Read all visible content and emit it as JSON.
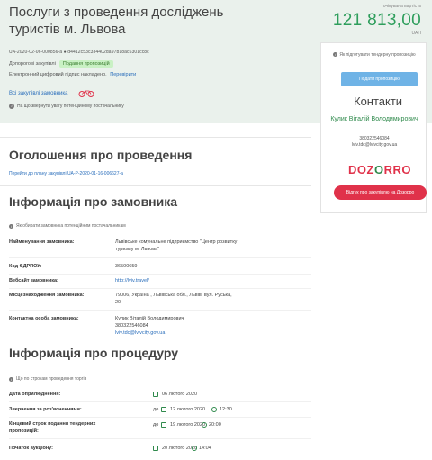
{
  "header": {
    "title": "Послуги з проведення досліджень туристів м. Львова",
    "tender_id": "UA-2020-02-06-000856-a ● d4412c53c334402da97b18ac6301cc8c",
    "procedure": "Допорогові закупівлі",
    "status": "Подання пропозицій",
    "signature_text": "Електронний цифровий підпис накладено.",
    "signature_link": "Перевірити",
    "all_purchases": "Всі закупівлі замовника",
    "notice": "На що звернути увагу потенційному постачальнику"
  },
  "value": {
    "label": "очікувана вартість",
    "amount": "121 813,00",
    "currency": "UAH"
  },
  "sidebar": {
    "help_question": "Як підготувати тендерну пропозицію",
    "ask_button": "Подати пропозицію",
    "contacts_title": "Контакти",
    "contact_name": "Кулик Віталій Володимирович",
    "contact_phone": "380322546084",
    "contact_email": "lviv.tdc@lvivcity.gov.ua",
    "logo_left": "DO",
    "logo_mid": "Z",
    "logo_o": "O",
    "logo_right": "RRO",
    "complain_button": "Відгук про закупівлю на Дозорро"
  },
  "announcement": {
    "title": "Оголошення про проведення",
    "plan_link": "Перейти до плану закупівлі UA-P-2020-01-16-006627-a"
  },
  "buyer": {
    "title": "Інформація про замовника",
    "notice": "Як обирати замовника потенційним постачальникам",
    "rows": [
      {
        "label": "Найменування замовника:",
        "value": "Львівське комунальне підприємство \"Центр розвитку туризму м. Львова\""
      },
      {
        "label": "Код ЄДРПОУ:",
        "value": "36500659"
      },
      {
        "label": "Вебсайт замовника:",
        "value": "http://lviv.travel/"
      },
      {
        "label": "Місцезнаходження замовника:",
        "value": "79006, Україна , Львівська обл., Львів, вул. Руська, 20"
      },
      {
        "label": "Контактна особа замовника:",
        "value_name": "Кулик Віталій Володимирович",
        "value_phone": "380322546084",
        "value_email": "lviv.tdc@lvivcity.gov.ua"
      }
    ]
  },
  "procedure": {
    "title": "Інформація про процедуру",
    "notice": "Що по строкам проведення торгів",
    "rows": [
      {
        "label": "Дата оприлюднення:",
        "date": "06 лютого 2020"
      },
      {
        "label": "Звернення за роз'ясненнями:",
        "prefix": "до",
        "date": "12 лютого 2020",
        "time": "12:30"
      },
      {
        "label": "Кінцевий строк подання тендерних пропозицій:",
        "prefix": "до",
        "date": "19 лютого 2020",
        "time": "20:00"
      },
      {
        "label": "Початок аукціону:",
        "date": "20 лютого 2020",
        "time": "14:04"
      }
    ]
  }
}
